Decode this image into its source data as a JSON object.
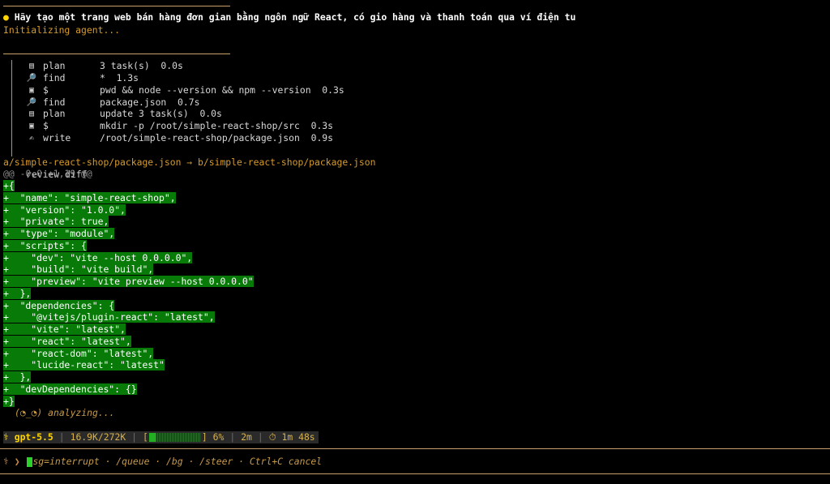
{
  "prompt": {
    "bullet": "●",
    "text": "Hãy tạo một trang web bán hàng đơn gian bằng ngôn ngữ React, có gio hàng và thanh toán qua ví điện tu"
  },
  "status_message": "Initializing agent...",
  "tool_calls": [
    {
      "icon": "clipboard-icon",
      "glyph": "▤",
      "name": "plan",
      "detail": "3 task(s)  0.0s"
    },
    {
      "icon": "magnifier-icon",
      "glyph": "🔎",
      "name": "find",
      "detail": "*  1.3s"
    },
    {
      "icon": "terminal-icon",
      "glyph": "▣",
      "name": "$",
      "detail": "pwd && node --version && npm --version  0.3s"
    },
    {
      "icon": "magnifier-icon",
      "glyph": "🔎",
      "name": "find",
      "detail": "package.json  0.7s"
    },
    {
      "icon": "clipboard-icon",
      "glyph": "▤",
      "name": "plan",
      "detail": "update 3 task(s)  0.0s"
    },
    {
      "icon": "terminal-icon",
      "glyph": "▣",
      "name": "$",
      "detail": "mkdir -p /root/simple-react-shop/src  0.3s"
    },
    {
      "icon": "pen-icon",
      "glyph": "✍",
      "name": "write",
      "detail": "/root/simple-react-shop/package.json  0.9s"
    }
  ],
  "review_label": "review diff",
  "diff": {
    "header": "a/simple-react-shop/package.json → b/simple-react-shop/package.json",
    "hunk": "@@ -0,0 +1,19 @@",
    "lines": [
      "+{",
      "+  \"name\": \"simple-react-shop\",",
      "+  \"version\": \"1.0.0\",",
      "+  \"private\": true,",
      "+  \"type\": \"module\",",
      "+  \"scripts\": {",
      "+    \"dev\": \"vite --host 0.0.0.0\",",
      "+    \"build\": \"vite build\",",
      "+    \"preview\": \"vite preview --host 0.0.0.0\"",
      "+  },",
      "+  \"dependencies\": {",
      "+    \"@vitejs/plugin-react\": \"latest\",",
      "+    \"vite\": \"latest\",",
      "+    \"react\": \"latest\",",
      "+    \"react-dom\": \"latest\",",
      "+    \"lucide-react\": \"latest\"",
      "+  },",
      "+  \"devDependencies\": {}",
      "+}"
    ]
  },
  "analyzing_text": "(◔_◔) analyzing...",
  "statusbar": {
    "model_glyph": "⚕",
    "model": "gpt-5.5",
    "tokens": "16.9K/272K",
    "progress_open": "[",
    "progress_close": "]",
    "progress_fraction": 0.06,
    "progress_label": "6%",
    "elapsed_short": "2m",
    "timer_glyph": "⏱",
    "elapsed": "1m 48s"
  },
  "input": {
    "prefix": "⚕ ❯",
    "hint": "sg=interrupt · /queue · /bg · /steer · Ctrl+C cancel"
  },
  "colors": {
    "background": "#000000",
    "rule": "#c9a06a",
    "accent": "#ffd500",
    "diff_add_bg": "#087a08",
    "orange_text": "#d79b2a"
  }
}
